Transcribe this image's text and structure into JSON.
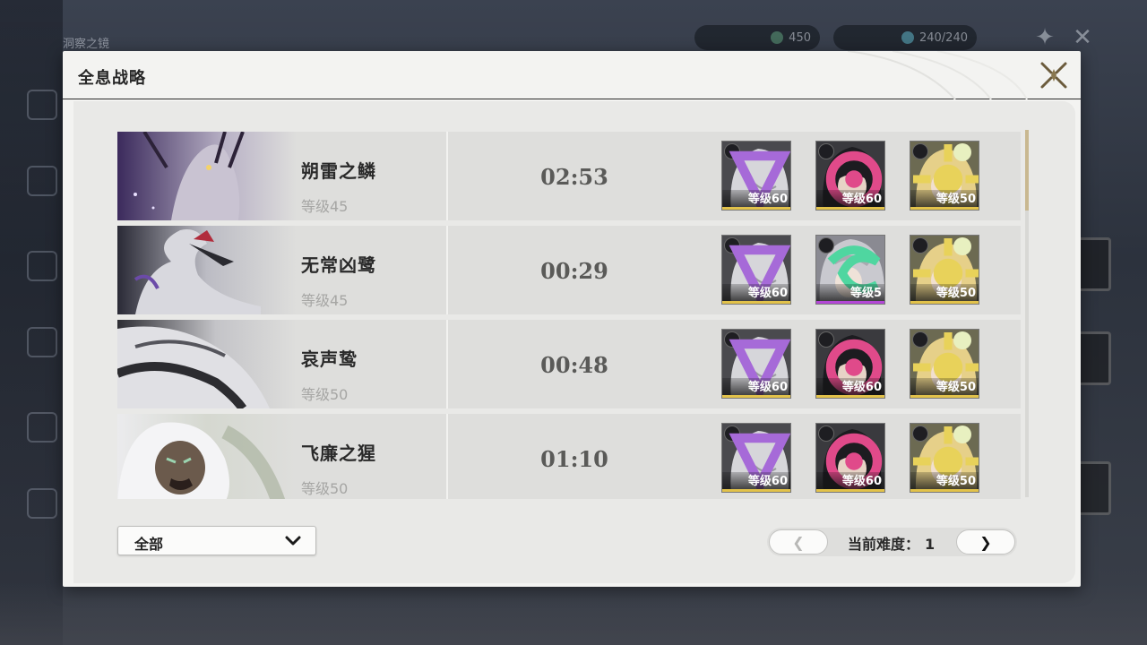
{
  "background": {
    "title": "洞察之镜",
    "currency_value": "450",
    "stamina_value": "240/240"
  },
  "modal": {
    "title": "全息战略"
  },
  "records": [
    {
      "boss_name": "朔雷之鳞",
      "boss_level": "等级45",
      "clear_time": "02:53",
      "team": [
        {
          "level": "等级60",
          "element": "havoc",
          "element_color": "#a66ad8",
          "portrait": "silver-hair"
        },
        {
          "level": "等级60",
          "element": "fusion",
          "element_color": "#e04a8a",
          "portrait": "black-hair"
        },
        {
          "level": "等级50",
          "element": "spectro",
          "element_color": "#e8d25a",
          "portrait": "blonde-hair"
        }
      ]
    },
    {
      "boss_name": "无常凶鹭",
      "boss_level": "等级45",
      "clear_time": "00:29",
      "team": [
        {
          "level": "等级60",
          "element": "havoc",
          "element_color": "#a66ad8",
          "portrait": "silver-hair"
        },
        {
          "level": "等级5",
          "element": "aero",
          "element_color": "#4fd6a0",
          "portrait": "grey-hair"
        },
        {
          "level": "等级50",
          "element": "spectro",
          "element_color": "#e8d25a",
          "portrait": "blonde-hair"
        }
      ]
    },
    {
      "boss_name": "哀声鸷",
      "boss_level": "等级50",
      "clear_time": "00:48",
      "team": [
        {
          "level": "等级60",
          "element": "havoc",
          "element_color": "#a66ad8",
          "portrait": "silver-hair"
        },
        {
          "level": "等级60",
          "element": "fusion",
          "element_color": "#e04a8a",
          "portrait": "black-hair"
        },
        {
          "level": "等级50",
          "element": "spectro",
          "element_color": "#e8d25a",
          "portrait": "blonde-hair"
        }
      ]
    },
    {
      "boss_name": "飞廉之猩",
      "boss_level": "等级50",
      "clear_time": "01:10",
      "team": [
        {
          "level": "等级60",
          "element": "havoc",
          "element_color": "#a66ad8",
          "portrait": "silver-hair"
        },
        {
          "level": "等级60",
          "element": "fusion",
          "element_color": "#e04a8a",
          "portrait": "black-hair"
        },
        {
          "level": "等级50",
          "element": "spectro",
          "element_color": "#e8d25a",
          "portrait": "blonde-hair"
        }
      ]
    }
  ],
  "filter": {
    "selected": "全部",
    "icon": "chevron-down-icon"
  },
  "pager": {
    "prev_label": "❮",
    "next_label": "❯",
    "difficulty_label": "当前难度：",
    "difficulty_value": "1"
  },
  "colors": {
    "accent_gold": "#c9b890",
    "panel_bg": "#f3f3f1",
    "row_bg": "#dededc"
  }
}
